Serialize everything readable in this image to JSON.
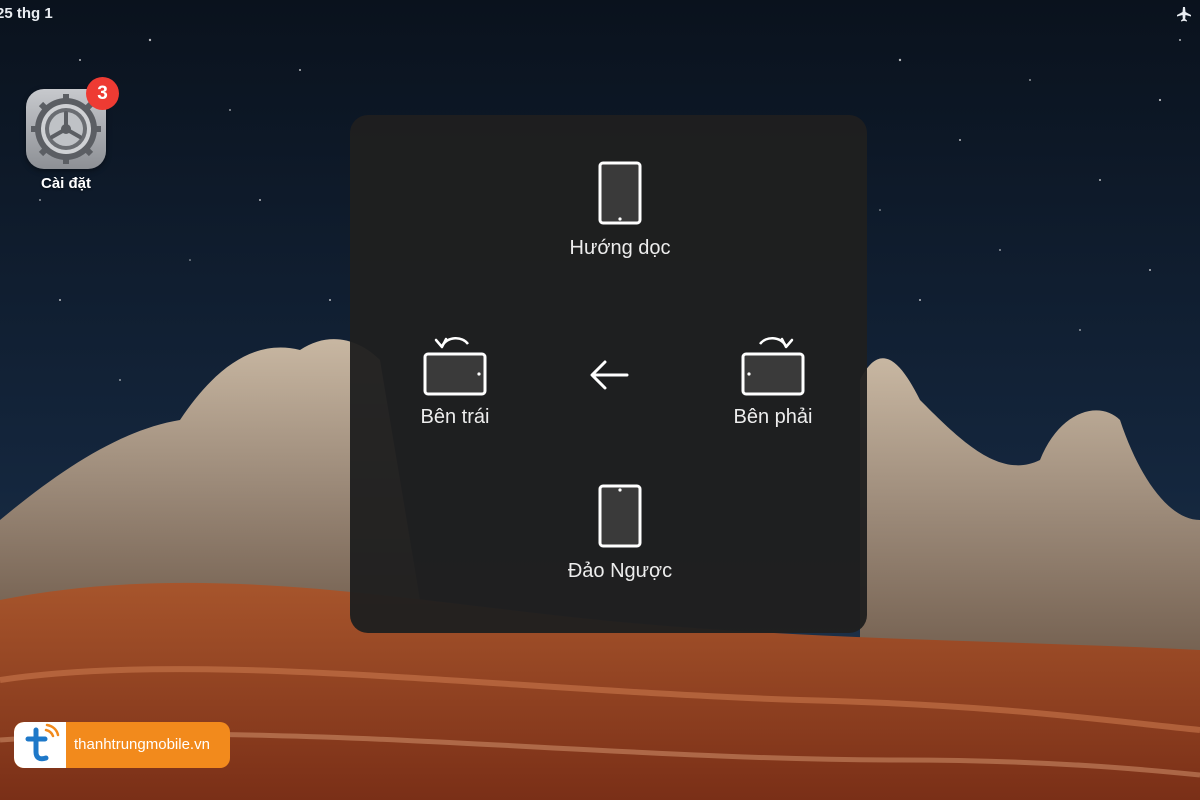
{
  "status_bar": {
    "date": "25 thg 1",
    "airplane_icon": "airplane-icon"
  },
  "home_screen": {
    "app": {
      "label": "Cài đặt",
      "icon": "settings-gear-icon",
      "badge": "3"
    }
  },
  "orientation_menu": {
    "options": {
      "portrait": {
        "label": "Hướng dọc",
        "icon": "tablet-portrait-icon"
      },
      "left": {
        "label": "Bên trái",
        "icon": "tablet-rotate-left-icon"
      },
      "right": {
        "label": "Bên phải",
        "icon": "tablet-rotate-right-icon"
      },
      "upside_down": {
        "label": "Đảo Ngược",
        "icon": "tablet-upside-down-icon"
      }
    },
    "back_icon": "arrow-left-icon"
  },
  "watermark": {
    "text": "thanhtrungmobile.vn",
    "logo_icon": "t-logo-icon"
  },
  "colors": {
    "badge": "#ee3b33",
    "panel": "#1f1f1f",
    "brand_orange": "#f28a1c"
  }
}
